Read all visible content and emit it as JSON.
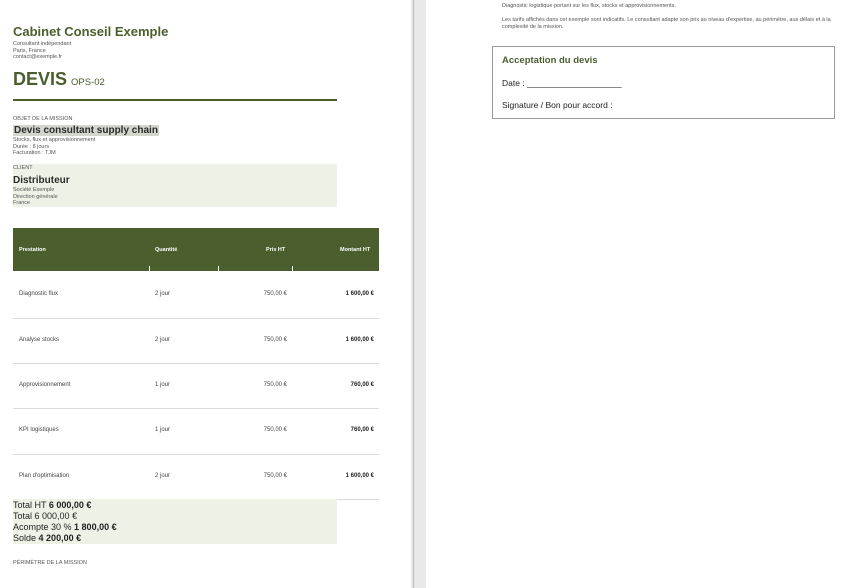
{
  "sender": {
    "firm_name": "Cabinet Conseil Exemple",
    "line1": "Consultant indépendant",
    "line2": "Paris, France",
    "line3": "contact@exemple.fr"
  },
  "document": {
    "type": "DEVIS",
    "reference": "OPS-02"
  },
  "mission": {
    "label": "OBJET DE LA MISSION",
    "title": "Devis consultant supply chain",
    "detail1": "Stocks, flux et approvisionnement",
    "detail2": "Durée : 8 jours",
    "detail3": "Facturation : TJM"
  },
  "client": {
    "label": "CLIENT",
    "name": "Distributeur",
    "line1": "Société Exemple",
    "line2": "Direction générale",
    "line3": "France"
  },
  "table": {
    "headers": [
      "Prestation",
      "Quantité",
      "Prix HT",
      "Montant HT"
    ],
    "rows": [
      {
        "prestation": "Diagnostic flux",
        "quantite": "2 jour",
        "prix": "750,00 €",
        "montant": "1 600,00 €"
      },
      {
        "prestation": "Analyse stocks",
        "quantite": "2 jour",
        "prix": "750,00 €",
        "montant": "1 600,00 €"
      },
      {
        "prestation": "Approvisionnement",
        "quantite": "1 jour",
        "prix": "750,00 €",
        "montant": "760,00 €"
      },
      {
        "prestation": "KPI logistiques",
        "quantite": "1 jour",
        "prix": "750,00 €",
        "montant": "760,00 €"
      },
      {
        "prestation": "Plan d'optimisation",
        "quantite": "2 jour",
        "prix": "750,00 €",
        "montant": "1 600,00 €"
      }
    ]
  },
  "totals": {
    "ht_label": "Total HT",
    "ht_value": "6 000,00 €",
    "total_label": "Total",
    "total_value": "6 000,00 €",
    "acompte_label": "Acompte 30 %",
    "acompte_value": "1 800,00 €",
    "solde_label": "Solde",
    "solde_value": "4 200,00 €"
  },
  "perimetre_label": "PÉRIMÈTRE DE LA MISSION",
  "right": {
    "text1": "Diagnostic logistique portant sur les flux, stocks et approvisionnements.",
    "text2": "Les tarifs affichés dans cet exemple sont indicatifs. Le consultant adapte son prix au niveau d'expertise, au périmètre, aux délais et à la complexité de la mission.",
    "acceptance_title": "Acceptation du devis",
    "date_label": "Date : ____________________",
    "signature_label": "Signature / Bon pour accord :"
  },
  "colors": {
    "accent": "#4b5e2d",
    "light_fill": "#eef2e6"
  }
}
